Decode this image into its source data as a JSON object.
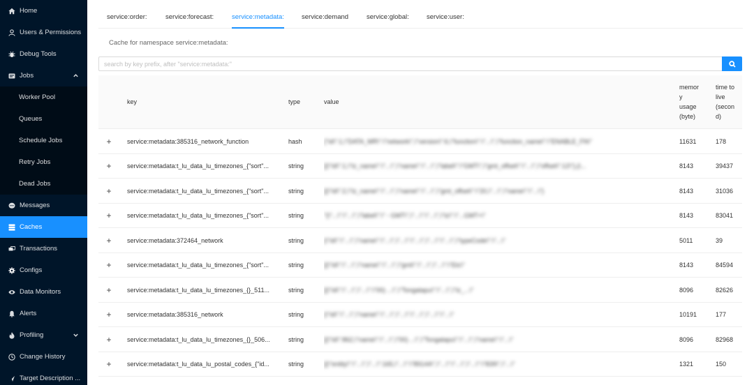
{
  "sidebar": {
    "items": [
      {
        "label": "Home",
        "icon": "home-icon"
      },
      {
        "label": "Users & Permissions",
        "icon": "user-icon"
      },
      {
        "label": "Debug Tools",
        "icon": "bug-icon"
      },
      {
        "label": "Jobs",
        "icon": "jobs-icon",
        "expanded": true
      },
      {
        "label": "Worker Pool",
        "sub": true
      },
      {
        "label": "Queues",
        "sub": true
      },
      {
        "label": "Schedule Jobs",
        "sub": true
      },
      {
        "label": "Retry Jobs",
        "sub": true
      },
      {
        "label": "Dead Jobs",
        "sub": true
      },
      {
        "label": "Messages",
        "icon": "message-icon"
      },
      {
        "label": "Caches",
        "icon": "cache-icon",
        "active": true
      },
      {
        "label": "Transactions",
        "icon": "transaction-icon"
      },
      {
        "label": "Configs",
        "icon": "gear-icon"
      },
      {
        "label": "Data Monitors",
        "icon": "eye-icon"
      },
      {
        "label": "Alerts",
        "icon": "bell-icon"
      },
      {
        "label": "Profiling",
        "icon": "flame-icon",
        "collapsed": true
      },
      {
        "label": "Change History",
        "icon": "history-icon"
      },
      {
        "label": "Target Description ...",
        "icon": "target-icon"
      }
    ]
  },
  "tabs": [
    {
      "label": "service:order:"
    },
    {
      "label": "service:forecast:"
    },
    {
      "label": "service:metadata:",
      "active": true
    },
    {
      "label": "service:demand"
    },
    {
      "label": "service:global:"
    },
    {
      "label": "service:user:"
    }
  ],
  "cache_title": "Cache for namespace service:metadata:",
  "search": {
    "placeholder": "search by key prefix, after \"service:metadata:\"",
    "value": ""
  },
  "table": {
    "headers": {
      "key": "key",
      "type": "type",
      "value": "value",
      "memory_lines": [
        "memor",
        "y",
        "usage",
        "(byte)"
      ],
      "ttl_lines": [
        "time to",
        "live",
        "(secon",
        "d)"
      ]
    },
    "expand_symbol": "+",
    "rows": [
      {
        "key": "service:metadata:385316_network_function",
        "type": "hash",
        "value": "{\"id\\\":1,\\\"DATA_MR\\\":\\\"network\\\",\\\"version\\\":6,\\\"function\\\":\\\"...\\\",\\\"function_name\\\":\\\"ENABLE_FN\\\"",
        "memory": "11631",
        "ttl": "178"
      },
      {
        "key": "service:metadata:t_lu_data_lu_timezones_{\"sort\"...",
        "type": "string",
        "value": "[{\\\"id\\\":1,\\\"tz_name\\\":\\\"...\\\",\\\"name\\\":\\\"...\\\",\\\"label\\\":\\\"GMT\\\",\\\"gmt_offset\\\":\\\"...\\\",\\\"offset\\\":12\\\"},{\\...",
        "memory": "8143",
        "ttl": "39437"
      },
      {
        "key": "service:metadata:t_lu_data_lu_timezones_{\"sort\"...",
        "type": "string",
        "value": "[{\\\"id\\\":2,\\\"tz_name\\\":\\\"...\\\",\\\"name\\\":\\\"...\\\",\\\"gmt_offset\\\":\\\"20,\\\"...\\\",\\\"name\\\":\\\"...\\\"}",
        "memory": "8143",
        "ttl": "31036"
      },
      {
        "key": "service:metadata:t_lu_data_lu_timezones_{\"sort\"...",
        "type": "string",
        "value": "\"{\\\"...\\\":\\\"...\\\",\\\"label\\\":\\\" - GMT\\\",\\\"...\\\":\\\"...\\\",\\\"tz\\\":\\\"...GMT+\\\"",
        "memory": "8143",
        "ttl": "83041"
      },
      {
        "key": "service:metadata:372464_network",
        "type": "string",
        "value": "{\\\"id\\\":\\\"...\\\",\\\"name\\\":\\\"...\\\",\\\"...\\\":\\\"...\\\",\\\"...\\\":\\\"...\\\",\\\"typeCode\\\":\\\"...\\\"",
        "memory": "5011",
        "ttl": "39"
      },
      {
        "key": "service:metadata:t_lu_data_lu_timezones_{\"sort\"...",
        "type": "string",
        "value": "[{\\\"id\\\":\\\"...\\\",\\\"name\\\":\\\"...\\\",\\\"gmt\\\":\\\"...\\\",\\\"...\\\":\\\"Etc\\\"",
        "memory": "8143",
        "ttl": "84594"
      },
      {
        "key": "service:metadata:t_lu_data_lu_timezones_{}_511...",
        "type": "string",
        "value": "[{\\\"id\\\":\\\"...\\\",\\\"...\\\":\\\"00) ...\\\",\\\"Tongatapu\\\":\\\"...\\\",\\\"tz_...\\\"",
        "memory": "8096",
        "ttl": "82626"
      },
      {
        "key": "service:metadata:385316_network",
        "type": "string",
        "value": "{\\\"id\\\":\\\"...\\\",\\\"name\\\":\\\"...\\\",\\\"...\\\":\\\"...\\\",\\\"...\\\":\\\"...\\\"",
        "memory": "10191",
        "ttl": "177"
      },
      {
        "key": "service:metadata:t_lu_data_lu_timezones_{}_506...",
        "type": "string",
        "value": "[{\\\"id\\\":862,\\\"name\\\":\\\"...\\\",\\\"00) ...\\\",\\\"Tongatapu\\\":\\\"...\\\",\\\"name\\\":\\\"...\\\"",
        "memory": "8096",
        "ttl": "82968"
      },
      {
        "key": "service:metadata:t_lu_data_lu_postal_codes_{\"id...",
        "type": "string",
        "value": "[{\\\"entity\\\":\\\"...\\\",\\\"...\\\":165,\\\"...\\\":\\\"89144\\\",\\\"...\\\":\\\"...\\\",\\\"...\\\":\\\"839\\\",\\\"...\\\"",
        "memory": "1321",
        "ttl": "150"
      }
    ]
  },
  "colors": {
    "sidebar_bg": "#001529",
    "submenu_bg": "#000c17",
    "accent": "#1890ff"
  }
}
